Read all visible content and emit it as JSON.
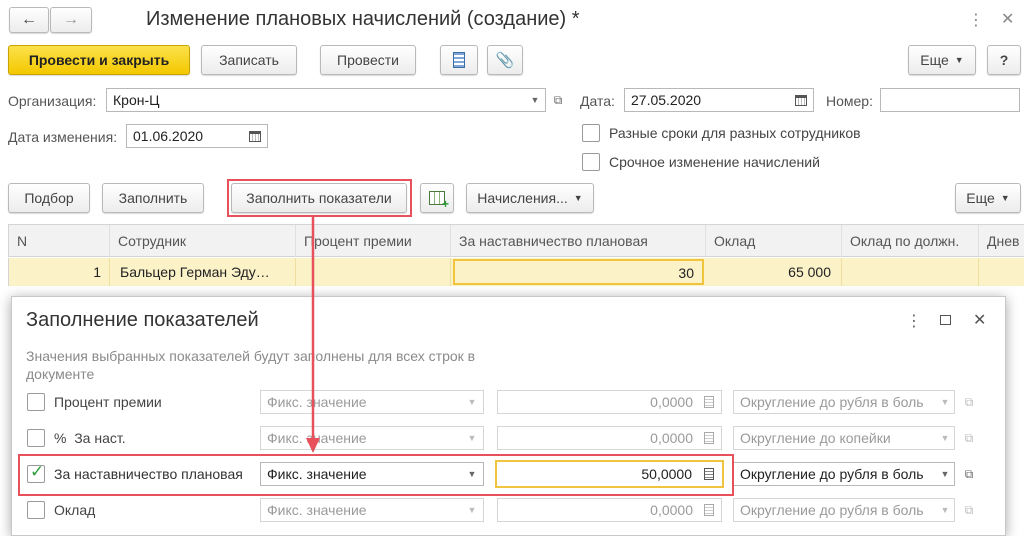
{
  "window": {
    "title": "Изменение плановых начислений (создание) *"
  },
  "toolbar": {
    "post_close_label": "Провести и закрыть",
    "save_label": "Записать",
    "post_label": "Провести",
    "more_label": "Еще",
    "help_label": "?"
  },
  "form": {
    "org_label": "Организация:",
    "org_value": "Крон-Ц",
    "date_label": "Дата:",
    "date_value": "27.05.2020",
    "number_label": "Номер:",
    "number_value": "",
    "change_date_label": "Дата изменения:",
    "change_date_value": "01.06.2020",
    "diff_terms_label": "Разные сроки для разных сотрудников",
    "urgent_label": "Срочное изменение начислений"
  },
  "table_toolbar": {
    "select_label": "Подбор",
    "fill_label": "Заполнить",
    "fill_indicators_label": "Заполнить показатели",
    "accruals_label": "Начисления...",
    "more_label": "Еще"
  },
  "table": {
    "columns": [
      "N",
      "Сотрудник",
      "Процент премии",
      "За наставничество плановая",
      "Оклад",
      "Оклад по должн.",
      "Днев"
    ],
    "rows": [
      {
        "n": "1",
        "employee": "Бальцер Герман Эду…",
        "bonus": "",
        "mentoring": "30",
        "salary": "65 000",
        "position_salary": "",
        "daily": ""
      }
    ]
  },
  "dialog": {
    "title": "Заполнение показателей",
    "hint": "Значения выбранных показателей будут заполнены для всех строк в документе",
    "rows": [
      {
        "label": "Процент премии",
        "checked": false,
        "mode": "Фикс. значение",
        "value": "0,0000",
        "rounding": "Округление до рубля в боль"
      },
      {
        "label": "%  За наст.",
        "checked": false,
        "mode": "Фикс. значение",
        "value": "0,0000",
        "rounding": "Округление до копейки"
      },
      {
        "label": "За наставничество плановая",
        "checked": true,
        "mode": "Фикс. значение",
        "value": "50,0000",
        "rounding": "Округление до рубля в боль"
      },
      {
        "label": "Оклад",
        "checked": false,
        "mode": "Фикс. значение",
        "value": "0,0000",
        "rounding": "Округление до рубля в боль"
      }
    ]
  },
  "colors": {
    "primary_button": "#f4c800",
    "highlight_red": "#e8505b",
    "selected_row": "#fbf2c8",
    "active_cell_border": "#f0c43c",
    "check_green": "#2e9c3a"
  }
}
